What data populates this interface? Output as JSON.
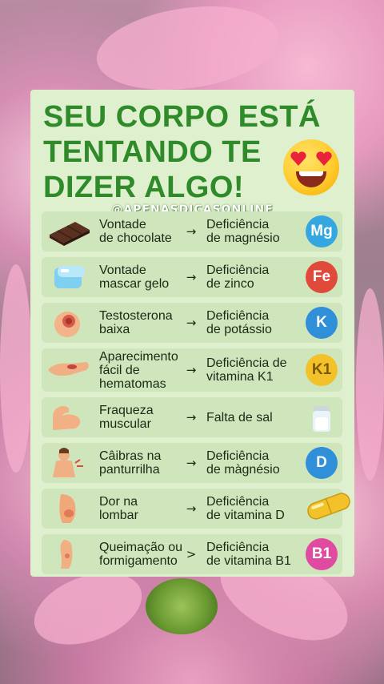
{
  "header": {
    "title_lines": [
      "SEU CORPO ESTÁ",
      "TENTANDO TE",
      "DIZER ALGO!"
    ],
    "emoji": "heart-eyes-emoji",
    "handle": "@APENASDICASONLINE"
  },
  "colors": {
    "title": "#2f8a2a",
    "card": "#dff0cf",
    "row": "#cfe6bd"
  },
  "rows": [
    {
      "cause": "Vontade\nde chocolate",
      "effect": "Deficiência\nde magnésio",
      "badge": "Mg",
      "badge_color": "#34a6e0",
      "icon": "chocolate-icon"
    },
    {
      "cause": "Vontade\nmascar gelo",
      "effect": "Deficiência\nde zinco",
      "badge": "Fe",
      "badge_color": "#e04a3a",
      "icon": "ice-cube-icon"
    },
    {
      "cause": "Testosterona\nbaixa",
      "effect": "Deficiência\nde potássio",
      "badge": "K",
      "badge_color": "#2f8fd8",
      "icon": "skin-spot-icon"
    },
    {
      "cause": "Aparecimento\nfácil de\nhematomas",
      "effect": "Deficiência de\nvitamina K1",
      "badge": "K1",
      "badge_color": "#f3c12a",
      "icon": "bruised-arm-icon"
    },
    {
      "cause": "Fraqueza\nmuscular",
      "effect": "Falta de sal",
      "badge": "",
      "badge_color": "",
      "icon": "flexed-arm-icon"
    },
    {
      "cause": "Câibras na\npanturrilha",
      "effect": "Deficiência\nde màgnésio",
      "badge": "D",
      "badge_color": "#2f8fd8",
      "icon": "cramp-icon"
    },
    {
      "cause": "Dor na\nlombar",
      "effect": "Deficiência\nde vitamina D",
      "badge": "",
      "badge_color": "",
      "icon": "lower-back-icon"
    },
    {
      "cause": "Queimação ou\nformigamento",
      "effect": "Deficiência\nde vitamina B1",
      "badge": "B1",
      "badge_color": "#e04aa0",
      "icon": "foot-icon"
    }
  ],
  "arrows": [
    "→",
    "→",
    "→",
    "→",
    "→",
    "→",
    "→",
    ">"
  ]
}
